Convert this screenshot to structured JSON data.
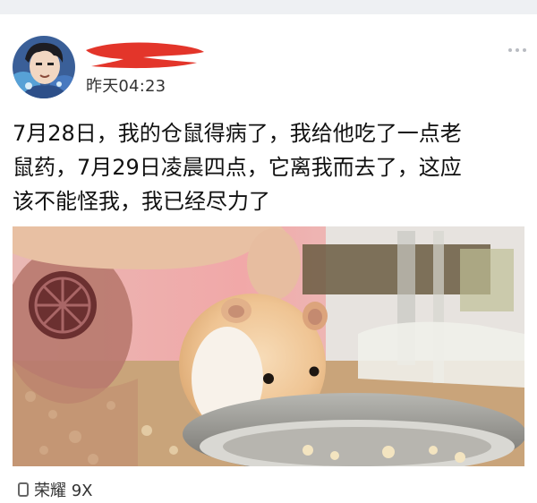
{
  "post": {
    "time": "昨天04:23",
    "text_lines": [
      "7月28日，我的仓鼠得病了，我给他吃了一点老",
      "鼠药，7月29日凌晨四点，它离我而去了，这应",
      "该不能怪我，我已经尽力了"
    ],
    "device": "荣耀 9X",
    "icons": {
      "more": "more-dots-icon",
      "device": "phone-icon"
    }
  },
  "colors": {
    "redaction": "#e3352a",
    "text": "#111111",
    "meta": "#333333",
    "menu_dots": "#b9bcc2"
  }
}
